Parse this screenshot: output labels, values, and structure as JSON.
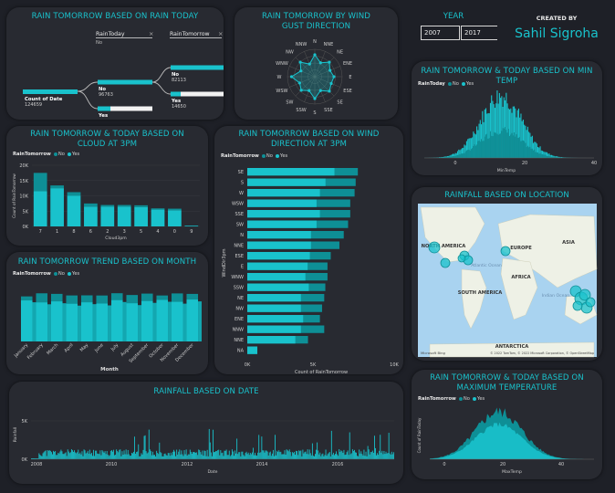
{
  "colors": {
    "teal": "#19c2cc",
    "dark_teal": "#0e8f96",
    "card": "#282a31",
    "bg": "#1e2027",
    "ocean": "#a9d3f0",
    "land": "#eef1e6"
  },
  "decomp": {
    "title": "RAIN TOMORROW BASED ON RAIN TODAY",
    "root_label": "Count of Date",
    "root_value": "124659",
    "header_today": "RainToday",
    "header_tomorrow": "RainTomorrow",
    "close": "×",
    "today_no_label": "No",
    "today_no_value": "96763",
    "today_yes_label": "Yes",
    "tom_no_label": "No",
    "tom_no_value": "82113",
    "tom_yes_label": "Yes",
    "tom_yes_value": "14650",
    "filter_value": "No"
  },
  "wind_gust": {
    "title": "RAIN TOMORROW BY WIND GUST DIRECTION",
    "directions": [
      "N",
      "NNE",
      "NE",
      "ENE",
      "E",
      "ESE",
      "SE",
      "SSE",
      "S",
      "SSW",
      "SW",
      "WSW",
      "W",
      "WNW",
      "NW",
      "NNW"
    ],
    "values": [
      0.8,
      0.55,
      0.75,
      0.6,
      0.7,
      0.65,
      0.75,
      0.55,
      0.8,
      0.55,
      0.7,
      0.6,
      0.85,
      0.55,
      0.75,
      0.5
    ]
  },
  "year": {
    "label": "YEAR",
    "from": "2007",
    "to": "2017"
  },
  "credit": {
    "label": "CREATED BY",
    "name": "Sahil Sigroha"
  },
  "min_temp": {
    "title": "RAIN TOMORROW & TODAY BASED ON MIN TEMP",
    "x_label": "MinTemp",
    "ticks": [
      "0",
      "20",
      "40"
    ]
  },
  "max_temp": {
    "title": "RAIN TOMORROW & TODAY BASED ON MAXIMUM TEMPERATURE",
    "x_label": "MaxTemp",
    "y_label": "Count of RainToday",
    "ticks": [
      "0",
      "20",
      "40"
    ]
  },
  "legend": {
    "title": "RainTomorrow",
    "no": "No",
    "yes": "Yes"
  },
  "legend2": {
    "title": "RainToday",
    "no": "No",
    "yes": "Yes"
  },
  "cloud": {
    "title": "RAIN TOMORROW & TODAY BASED ON CLOUD AT 3PM",
    "x_label": "Cloud3pm",
    "y_label": "Count of RainTomorrow",
    "y_ticks": [
      "20K",
      "15K",
      "10K",
      "5K",
      "0K"
    ],
    "categories": [
      "7",
      "1",
      "8",
      "6",
      "2",
      "3",
      "5",
      "4",
      "0",
      "9"
    ],
    "no": [
      11.5,
      12.5,
      10,
      6.5,
      6.5,
      6.5,
      6.3,
      5.5,
      5.3,
      0.2
    ],
    "yes": [
      6,
      0.9,
      1.2,
      1.0,
      0.5,
      0.5,
      0.6,
      0.4,
      0.5,
      0.1
    ]
  },
  "wind_dir": {
    "title": "RAIN TOMORROW BASED ON WIND DIRECTION AT 3PM",
    "x_label": "Count of RainTomorrow",
    "y_label": "WindDir3pm",
    "x_ticks": [
      "0K",
      "5K",
      "10K"
    ],
    "categories": [
      "SE",
      "S",
      "W",
      "WSW",
      "SSE",
      "SW",
      "N",
      "NNE",
      "ESE",
      "E",
      "WNW",
      "SSW",
      "NE",
      "NW",
      "ENE",
      "NNW",
      "NNE ",
      "NA"
    ],
    "no": [
      7.8,
      7.0,
      6.5,
      6.2,
      6.5,
      6.2,
      5.7,
      5.7,
      5.6,
      5.4,
      5.2,
      5.5,
      4.8,
      4.8,
      5.0,
      4.8,
      4.3,
      0.9
    ],
    "total": [
      10.2,
      10.0,
      9.9,
      9.5,
      9.5,
      9.3,
      8.9,
      8.5,
      7.7,
      7.4,
      7.4,
      7.2,
      7.1,
      6.9,
      6.7,
      7.1,
      5.6,
      0.9
    ]
  },
  "trend": {
    "title": "RAIN TOMORROW TREND BASED ON MONTH",
    "x_label": "Month",
    "months": [
      "January",
      "February",
      "March",
      "April",
      "May",
      "June",
      "July",
      "August",
      "September",
      "October",
      "November",
      "December"
    ]
  },
  "date_chart": {
    "title": "RAINFALL BASED ON DATE",
    "y_label": "Rainfall",
    "x_label": "Date",
    "x_ticks": [
      "2008",
      "2010",
      "2012",
      "2014",
      "2016"
    ],
    "y_ticks": [
      "5K",
      "0K"
    ]
  },
  "map": {
    "title": "RAINFALL BASED ON LOCATION",
    "continents": [
      "NORTH AMERICA",
      "EUROPE",
      "ASIA",
      "Atlantic Ocean",
      "AFRICA",
      "SOUTH AMERICA",
      "Indian Ocean",
      "ANTARCTICA"
    ],
    "copyright": "© 2022 TomTom, © 2022 Microsoft Corporation, © OpenStreetMap",
    "brand": "Microsoft Bing"
  }
}
